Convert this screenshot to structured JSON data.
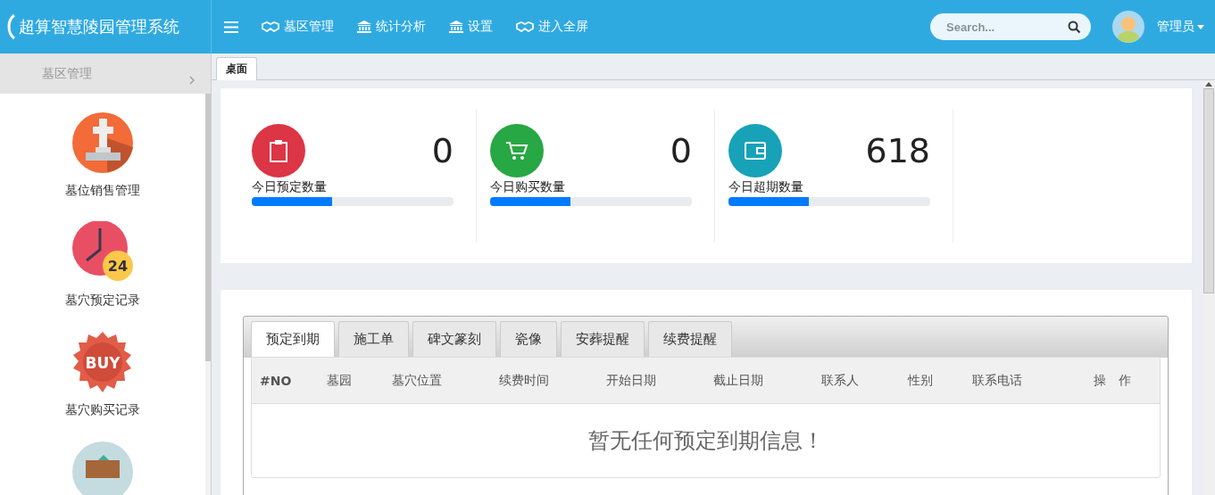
{
  "header": {
    "title": "超算智慧陵园管理系统",
    "nav": [
      {
        "label": "墓区管理",
        "kind": "handshake"
      },
      {
        "label": "统计分析",
        "kind": "bank"
      },
      {
        "label": "设置",
        "kind": "bank"
      },
      {
        "label": "进入全屏",
        "kind": "handshake"
      }
    ],
    "search": {
      "placeholder": "Search..."
    },
    "user": "管理员"
  },
  "sidebar": {
    "section": "墓区管理",
    "items": [
      {
        "label": "墓位销售管理",
        "kind": "tomb"
      },
      {
        "label": "墓穴预定记录",
        "kind": "clock",
        "badge": "24"
      },
      {
        "label": "墓穴购买记录",
        "kind": "buy",
        "badge": "BUY"
      },
      {
        "kind": "wallet"
      }
    ]
  },
  "page_tabs": [
    {
      "label": "桌面",
      "selected": true
    }
  ],
  "stats": [
    {
      "label": "今日预定数量",
      "value": "0",
      "kind": "clipboard",
      "color": "#dc3545",
      "level": 0.4
    },
    {
      "label": "今日购买数量",
      "value": "0",
      "kind": "cart",
      "color": "#28a745",
      "level": 0.4
    },
    {
      "label": "今日超期数量",
      "value": "618",
      "kind": "wallet",
      "color": "#17a2b8",
      "level": 0.4
    }
  ],
  "panel": {
    "tabs": [
      {
        "label": "预定到期",
        "selected": true
      },
      {
        "label": "施工单",
        "selected": false
      },
      {
        "label": "碑文篆刻",
        "selected": false
      },
      {
        "label": "瓷像",
        "selected": false
      },
      {
        "label": "安葬提醒",
        "selected": false
      },
      {
        "label": "续费提醒",
        "selected": false
      }
    ],
    "columns": [
      "#NO",
      "墓园",
      "墓穴位置",
      "续费时间",
      "开始日期",
      "截止日期",
      "联系人",
      "性别",
      "联系电话",
      "操　作"
    ],
    "empty": "暂无任何预定到期信息！"
  }
}
